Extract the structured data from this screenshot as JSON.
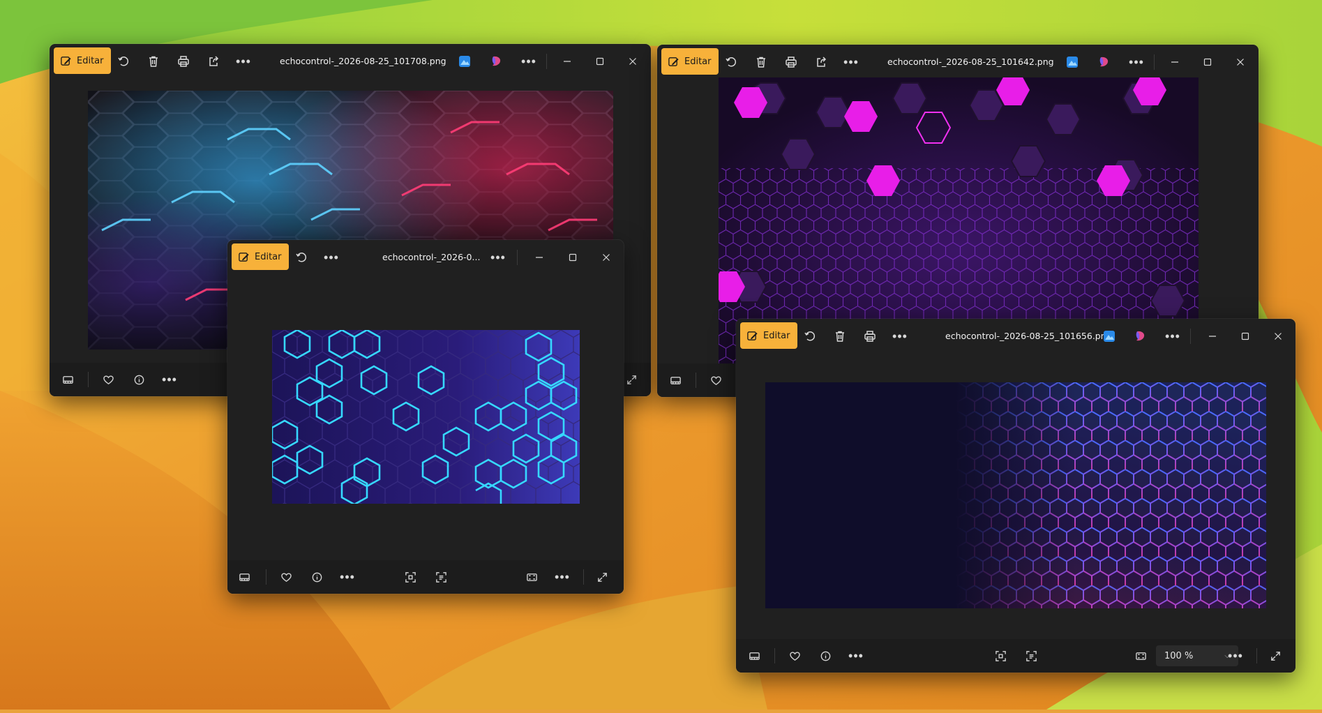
{
  "colors": {
    "accent": "#f7b13a",
    "window_bg": "#202020",
    "bar_bg": "#1c1c1c"
  },
  "windows": [
    {
      "id": "w1",
      "edit_label": "Editar",
      "title": "echocontrol-_2026-08-25_101708.png",
      "more": "•••"
    },
    {
      "id": "w2",
      "edit_label": "Editar",
      "title": "echocontrol-_2026-08-25_101642.png",
      "more": "•••"
    },
    {
      "id": "w3",
      "edit_label": "Editar",
      "title": "echocontrol-_2026-0...",
      "more": "•••"
    },
    {
      "id": "w4",
      "edit_label": "Editar",
      "title": "echocontrol-_2026-08-25_101656.png",
      "more": "•••",
      "zoom": "100 %"
    }
  ],
  "icons": [
    "edit-icon",
    "rotate-icon",
    "delete-icon",
    "print-icon",
    "share-icon",
    "more-icon",
    "photos-app-icon",
    "copilot-icon",
    "minimize-icon",
    "maximize-icon",
    "close-icon",
    "filmstrip-icon",
    "favorite-icon",
    "info-icon",
    "crop-icon",
    "ocr-icon",
    "fit-icon",
    "fullscreen-icon",
    "chevron-down-icon"
  ]
}
